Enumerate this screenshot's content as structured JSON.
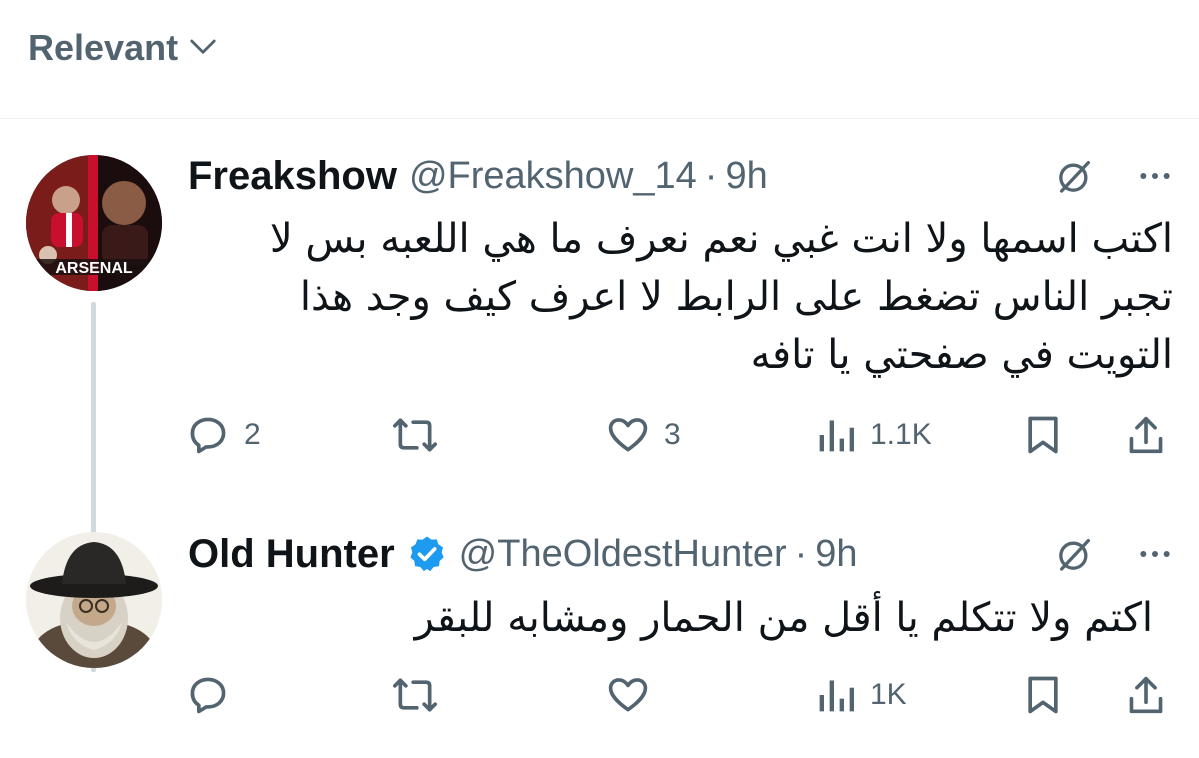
{
  "sort": {
    "label": "Relevant"
  },
  "tweets": [
    {
      "display_name": "Freakshow",
      "handle": "@Freakshow_14",
      "separator": "·",
      "time": "9h",
      "verified": false,
      "avatar_text": "ARSENAL",
      "text": "اكتب اسمها ولا انت غبي نعم نعرف ما هي اللعبه بس لا تجبر الناس تضغط على الرابط لا اعرف كيف وجد هذا التويت في صفحتي يا تافه",
      "replies": "2",
      "reposts": "",
      "likes": "3",
      "views": "1.1K"
    },
    {
      "display_name": "Old Hunter",
      "handle": "@TheOldestHunter",
      "separator": "·",
      "time": "9h",
      "verified": true,
      "text": "اكتم ولا تتكلم يا أقل من الحمار ومشابه للبقر",
      "replies": "",
      "reposts": "",
      "likes": "",
      "views": "1K"
    }
  ],
  "icons": {
    "sort_chevron": "chevron-down-icon",
    "grok": "grok-icon",
    "more": "more-dots-icon",
    "reply": "reply-icon",
    "repost": "repost-icon",
    "like": "heart-icon",
    "views": "views-chart-icon",
    "bookmark": "bookmark-icon",
    "share": "share-icon",
    "verified": "verified-badge-icon"
  },
  "colors": {
    "text_primary": "#0f1419",
    "text_secondary": "#536471",
    "verified_blue": "#1d9bf0",
    "thread_line": "#cfd9de"
  }
}
